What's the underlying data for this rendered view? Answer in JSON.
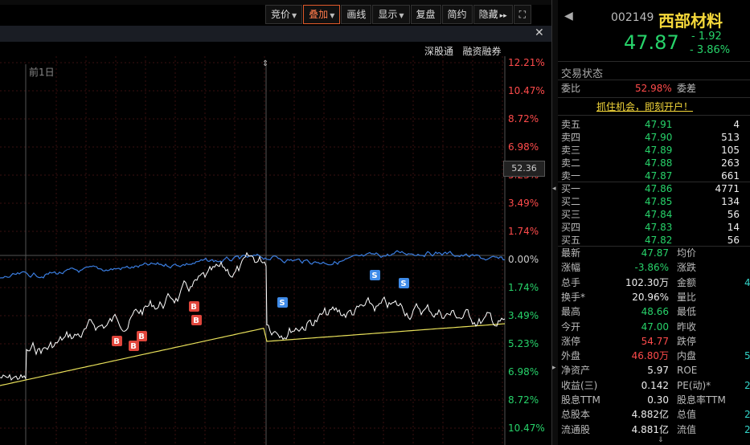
{
  "toolbar": {
    "items": [
      "竞价",
      "叠加",
      "画线",
      "显示",
      "复盘",
      "简约",
      "隐藏"
    ],
    "expand": "▸▸"
  },
  "tags": [
    "深股通",
    "融资融券"
  ],
  "chart": {
    "prev_day_label": "前1日",
    "right_labels": [
      "12.21%",
      "10.47%",
      "8.72%",
      "6.98%",
      "5.23%",
      "3.49%",
      "1.74%",
      "0.00%",
      "1.74%",
      "3.49%",
      "5.23%",
      "6.98%",
      "8.72%",
      "10.47%"
    ],
    "price_box": "52.36",
    "b_marker": "B",
    "s_marker": "S",
    "colors": {
      "up": "#ff4b4b",
      "down": "#27d36a",
      "line": "#ffffff",
      "avg": "#e8e05a",
      "blue": "#3a7de0"
    }
  },
  "header": {
    "code": "002149",
    "name": "西部材料",
    "price": "47.87",
    "change": "- 1.92",
    "pct": "- 3.86%"
  },
  "status": {
    "label": "交易状态",
    "wb_label": "委比",
    "wb_value": "52.98%",
    "wc_label": "委差",
    "promo": "抓住机会，即刻开户！"
  },
  "asks": [
    {
      "label": "卖五",
      "price": "47.91",
      "vol": "4"
    },
    {
      "label": "卖四",
      "price": "47.90",
      "vol": "513"
    },
    {
      "label": "卖三",
      "price": "47.89",
      "vol": "105"
    },
    {
      "label": "卖二",
      "price": "47.88",
      "vol": "263"
    },
    {
      "label": "卖一",
      "price": "47.87",
      "vol": "661"
    }
  ],
  "bids": [
    {
      "label": "买一",
      "price": "47.86",
      "vol": "4771"
    },
    {
      "label": "买二",
      "price": "47.85",
      "vol": "134"
    },
    {
      "label": "买三",
      "price": "47.84",
      "vol": "56"
    },
    {
      "label": "买四",
      "price": "47.83",
      "vol": "14"
    },
    {
      "label": "买五",
      "price": "47.82",
      "vol": "56"
    }
  ],
  "stats": [
    {
      "l1": "最新",
      "v1": "47.87",
      "c1": "green",
      "l2": "均价",
      "v2": ""
    },
    {
      "l1": "涨幅",
      "v1": "-3.86%",
      "c1": "green",
      "l2": "涨跌",
      "v2": ""
    },
    {
      "l1": "总手",
      "v1": "102.30万",
      "c1": "white",
      "l2": "金额",
      "v2": "4"
    },
    {
      "l1": "换手*",
      "v1": "20.96%",
      "c1": "white",
      "l2": "量比",
      "v2": ""
    },
    {
      "l1": "最高",
      "v1": "48.66",
      "c1": "green",
      "l2": "最低",
      "v2": ""
    },
    {
      "l1": "今开",
      "v1": "47.00",
      "c1": "green",
      "l2": "昨收",
      "v2": ""
    },
    {
      "l1": "涨停",
      "v1": "54.77",
      "c1": "red",
      "l2": "跌停",
      "v2": ""
    },
    {
      "l1": "外盘",
      "v1": "46.80万",
      "c1": "red",
      "l2": "内盘",
      "v2": "5"
    },
    {
      "l1": "净资产",
      "v1": "5.97",
      "c1": "white",
      "l2": "ROE",
      "v2": ""
    },
    {
      "l1": "收益(三)",
      "v1": "0.142",
      "c1": "white",
      "l2": "PE(动)*",
      "v2": "2"
    },
    {
      "l1": "股息TTM",
      "v1": "0.30",
      "c1": "white",
      "l2": "股息率TTM",
      "v2": ""
    },
    {
      "l1": "总股本",
      "v1": "4.882亿",
      "c1": "white",
      "l2": "总值",
      "v2": "2"
    },
    {
      "l1": "流通股",
      "v1": "4.881亿",
      "c1": "white",
      "l2": "流值",
      "v2": "2"
    }
  ]
}
